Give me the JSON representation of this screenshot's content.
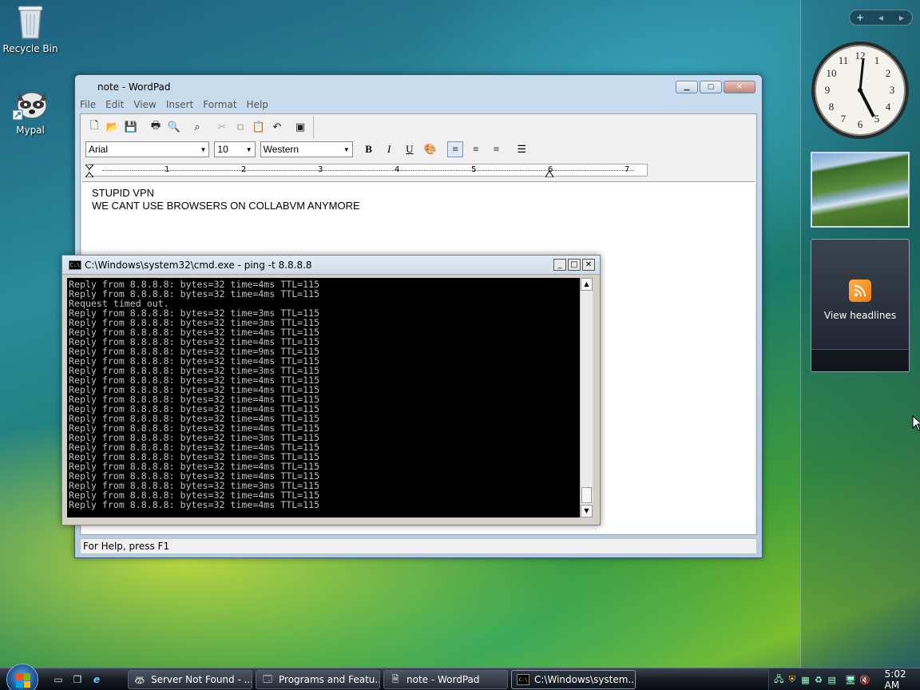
{
  "desktop": {
    "icons": [
      {
        "label": "Recycle Bin",
        "icon": "recycle-bin-icon"
      },
      {
        "label": "Mypal",
        "icon": "raccoon-browser-icon"
      }
    ]
  },
  "sidebar": {
    "controls": {
      "add": "+",
      "prev": "◀",
      "next": "▶"
    },
    "feed_label": "View headlines"
  },
  "wordpad": {
    "title": "note - WordPad",
    "menu": [
      "File",
      "Edit",
      "View",
      "Insert",
      "Format",
      "Help"
    ],
    "font": "Arial",
    "size": "10",
    "script": "Western",
    "ruler_numbers": [
      "1",
      "2",
      "3",
      "4",
      "5",
      "6",
      "7"
    ],
    "lines": [
      "STUPID VPN",
      "WE CANT USE BROWSERS ON COLLABVM ANYMORE"
    ],
    "status": "For Help, press F1"
  },
  "cmd": {
    "title": "C:\\Windows\\system32\\cmd.exe - ping  -t 8.8.8.8",
    "output": [
      "Reply from 8.8.8.8: bytes=32 time=4ms TTL=115",
      "Reply from 8.8.8.8: bytes=32 time=4ms TTL=115",
      "Request timed out.",
      "Reply from 8.8.8.8: bytes=32 time=3ms TTL=115",
      "Reply from 8.8.8.8: bytes=32 time=3ms TTL=115",
      "Reply from 8.8.8.8: bytes=32 time=4ms TTL=115",
      "Reply from 8.8.8.8: bytes=32 time=4ms TTL=115",
      "Reply from 8.8.8.8: bytes=32 time=9ms TTL=115",
      "Reply from 8.8.8.8: bytes=32 time=4ms TTL=115",
      "Reply from 8.8.8.8: bytes=32 time=3ms TTL=115",
      "Reply from 8.8.8.8: bytes=32 time=4ms TTL=115",
      "Reply from 8.8.8.8: bytes=32 time=4ms TTL=115",
      "Reply from 8.8.8.8: bytes=32 time=4ms TTL=115",
      "Reply from 8.8.8.8: bytes=32 time=4ms TTL=115",
      "Reply from 8.8.8.8: bytes=32 time=4ms TTL=115",
      "Reply from 8.8.8.8: bytes=32 time=4ms TTL=115",
      "Reply from 8.8.8.8: bytes=32 time=3ms TTL=115",
      "Reply from 8.8.8.8: bytes=32 time=4ms TTL=115",
      "Reply from 8.8.8.8: bytes=32 time=3ms TTL=115",
      "Reply from 8.8.8.8: bytes=32 time=4ms TTL=115",
      "Reply from 8.8.8.8: bytes=32 time=4ms TTL=115",
      "Reply from 8.8.8.8: bytes=32 time=3ms TTL=115",
      "Reply from 8.8.8.8: bytes=32 time=4ms TTL=115",
      "Reply from 8.8.8.8: bytes=32 time=4ms TTL=115"
    ]
  },
  "taskbar": {
    "tasks": [
      {
        "label": "Server Not Found - ...",
        "icon": "raccoon-browser-icon"
      },
      {
        "label": "Programs and Featu...",
        "icon": "control-panel-icon"
      },
      {
        "label": "note - WordPad",
        "icon": "wordpad-icon"
      },
      {
        "label": "C:\\Windows\\system...",
        "icon": "cmd-icon"
      }
    ],
    "time": "5:02 AM"
  },
  "colors": {
    "console_bg": "#000000",
    "console_fg": "#c0c0c0",
    "taskbar": "#161b22"
  }
}
